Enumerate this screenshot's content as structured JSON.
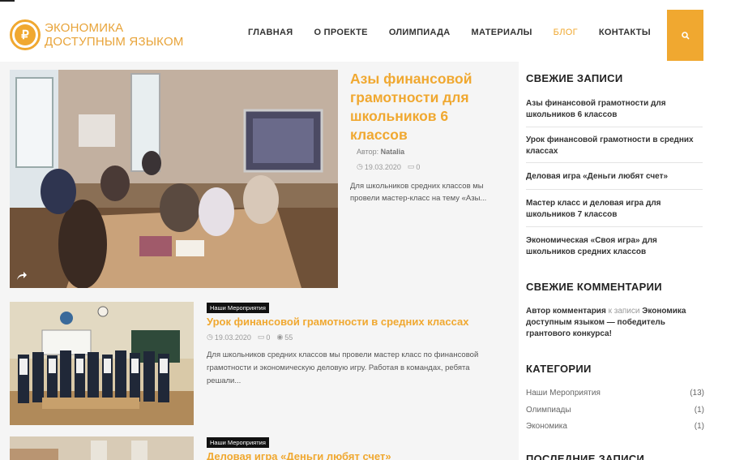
{
  "header": {
    "logo_line1": "ЭКОНОМИКА",
    "logo_line2": "ДОСТУПНЫМ ЯЗЫКОМ",
    "nav": [
      {
        "label": "ГЛАВНАЯ"
      },
      {
        "label": "О ПРОЕКТЕ"
      },
      {
        "label": "ОЛИМПИАДА"
      },
      {
        "label": "МАТЕРИАЛЫ"
      },
      {
        "label": "БЛОГ",
        "active": true
      },
      {
        "label": "КОНТАКТЫ"
      }
    ],
    "accent_color": "#f0a830"
  },
  "feature": {
    "title": "Азы финансовой грамотности для школьников 6 классов",
    "author_label": "Автор:",
    "author": "Natalia",
    "date": "19.03.2020",
    "comments": "0",
    "excerpt": "Для школьников средних классов мы провели мастер-класс на тему «Азы..."
  },
  "posts": [
    {
      "category": "Наши Мероприятия",
      "title": "Урок финансовой грамотности в средних классах",
      "date": "19.03.2020",
      "comments": "0",
      "views": "55",
      "excerpt": "Для школьников средних классов мы провели мастер класс по финансовой грамотности и экономическую деловую игру. Работая в командах, ребята решали..."
    },
    {
      "category": "Наши Мероприятия",
      "title": "Деловая игра «Деньги любят счет»"
    }
  ],
  "sidebar": {
    "recent_title": "СВЕЖИЕ ЗАПИСИ",
    "recent": [
      "Азы финансовой грамотности для школьников 6 классов",
      "Урок финансовой грамотности в средних классах",
      "Деловая игра «Деньги любят счет»",
      "Мастер класс и деловая игра для школьников 7 классов",
      "Экономическая «Своя игра» для школьников средних классов"
    ],
    "comments_title": "СВЕЖИЕ КОММЕНТАРИИ",
    "comment": {
      "author": "Автор комментария",
      "connector": "к записи",
      "post": "Экономика доступным языком — победитель грантового конкурса!"
    },
    "categories_title": "КАТЕГОРИИ",
    "categories": [
      {
        "name": "Наши Мероприятия",
        "count": "(13)"
      },
      {
        "name": "Олимпиады",
        "count": "(1)"
      },
      {
        "name": "Экономика",
        "count": "(1)"
      }
    ],
    "last_title": "ПОСЛЕДНИЕ ЗАПИСИ"
  }
}
